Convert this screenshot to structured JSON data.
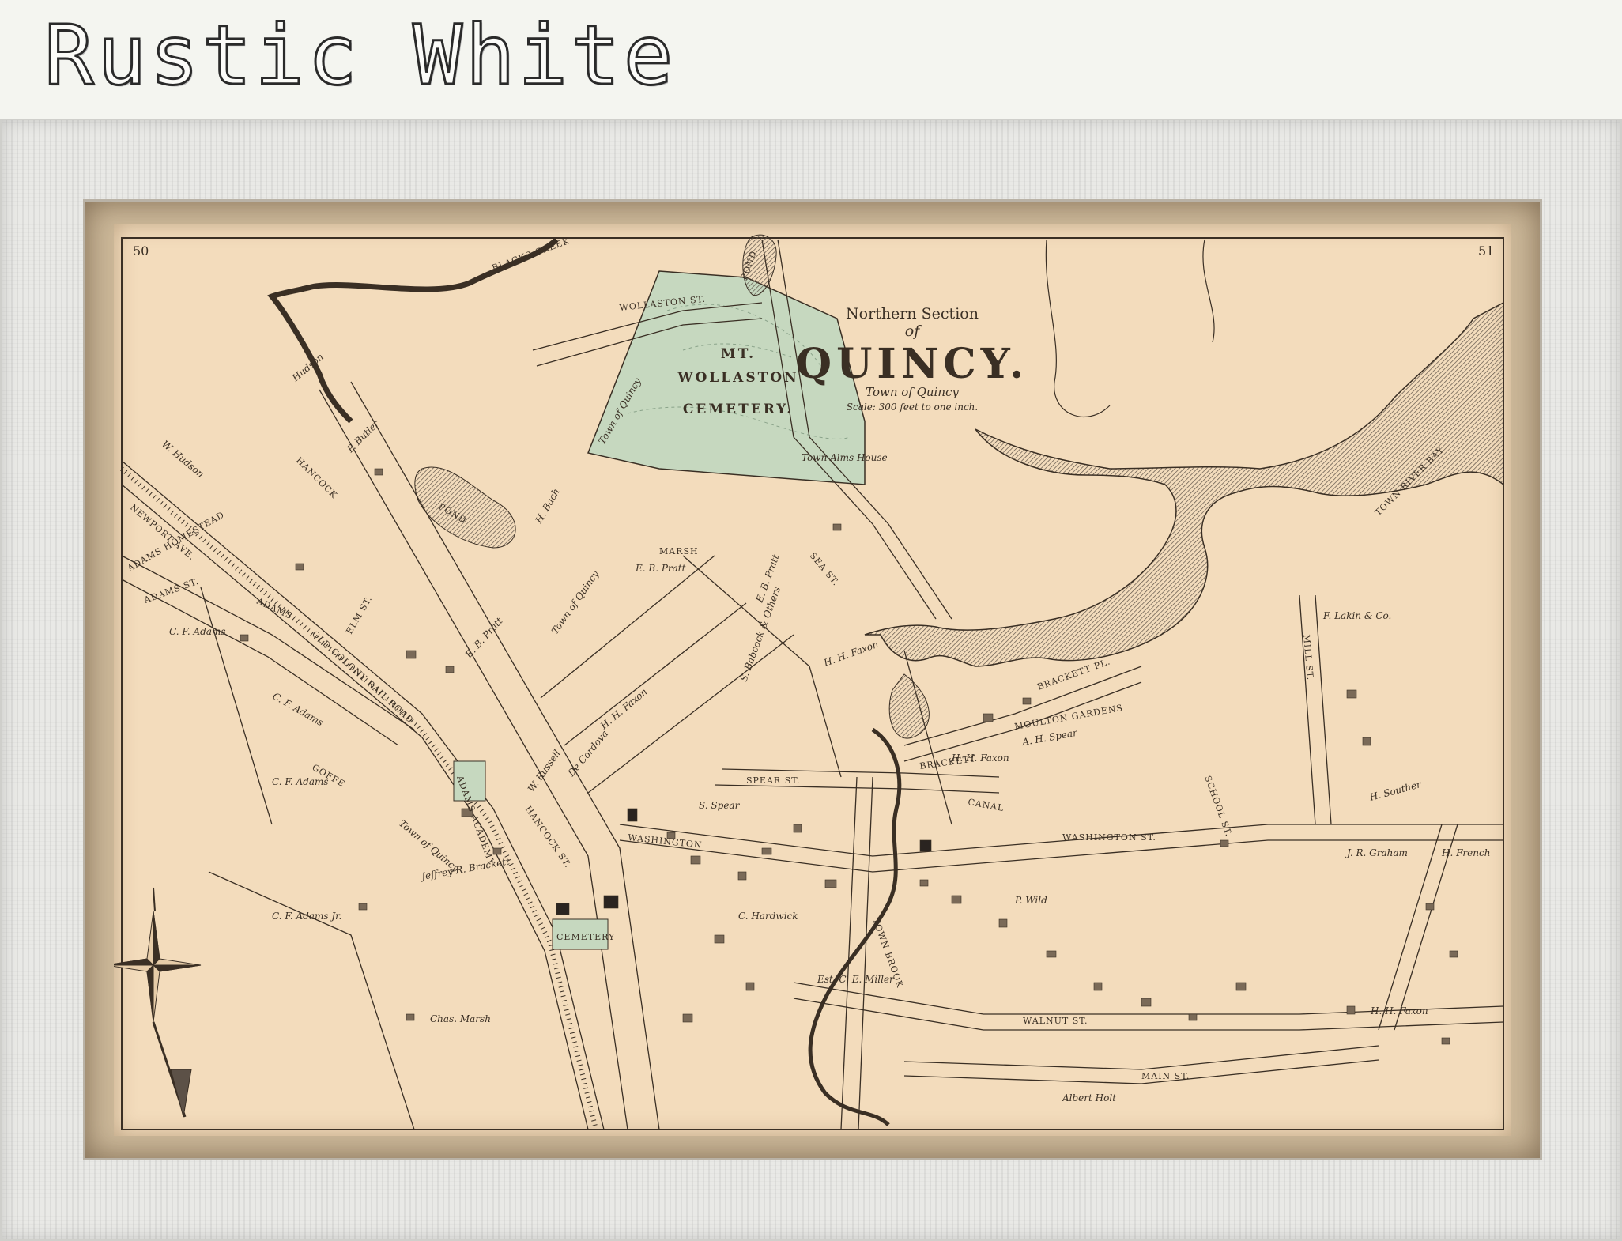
{
  "header": {
    "title": "Rustic White"
  },
  "map": {
    "page_left": "50",
    "page_right": "51",
    "title_line1": "Northern Section",
    "title_of": "of",
    "title_main": "QUINCY.",
    "subtitle": "Town of Quincy",
    "scale": "Scale: 300 feet to one inch.",
    "cemetery": [
      "MT.",
      "WOLLASTON",
      "CEMETERY."
    ],
    "water": {
      "blacks_creek": "BLACKS CREEK",
      "pond_top": "POND",
      "pond_left": "POND",
      "town_river_bay": "TOWN RIVER BAY",
      "town_brook": "TOWN BROOK"
    },
    "streets": {
      "wollaston": "WOLLASTON ST.",
      "hancock": "HANCOCK",
      "hancock_lower": "HANCOCK ST.",
      "newport": "NEWPORT AVE.",
      "adams": "ADAMS ST.",
      "adams_upper": "ADAMS",
      "old_colony": "OLD COLONY RAIL ROAD",
      "washington": "WASHINGTON",
      "washington_east": "WASHINGTON ST.",
      "spear": "SPEAR ST.",
      "brackett": "BRACKETT",
      "brackett_pl": "BRACKETT PL.",
      "walnut": "WALNUT ST.",
      "main": "MAIN ST.",
      "canal": "CANAL",
      "sea": "SEA ST.",
      "goffe": "GOFFE",
      "elm": "ELM ST.",
      "mill": "MILL ST.",
      "school": "SCHOOL ST."
    },
    "owners": {
      "hudson": "Hudson",
      "w_hudson": "W. Hudson",
      "p_butler": "P. Butler",
      "adams_homestead": "ADAMS HOMESTEAD",
      "cf_adams_1": "C. F. Adams",
      "cf_adams_2": "C. F. Adams",
      "cf_adams_3": "C. F. Adams",
      "cf_adams_jr": "C. F. Adams Jr.",
      "eb_pratt_1": "E. B. Pratt",
      "eb_pratt_2": "E. B. Pratt",
      "eb_pratt_3": "E. B. Pratt",
      "marsh": "MARSH",
      "hh_faxon_1": "H. H. Faxon",
      "hh_faxon_2": "H. H. Faxon",
      "hh_faxon_3": "H. H. Faxon",
      "p_wild": "P. Wild",
      "jr_graham": "J. R. Graham",
      "h_french": "H. French",
      "jeffrey_brackett": "Jeffrey R. Brackett",
      "chas_marsh": "Chas. Marsh",
      "h_bach": "H. Bach",
      "s_babcock": "S. Babcock & Others",
      "town_alms_house": "Town Alms House",
      "town_of_quincy_1": "Town of Quincy",
      "town_of_quincy_2": "Town of Quincy",
      "town_of_quincy_3": "Town of Quincy",
      "cemetery_small": "CEMETERY",
      "adams_academy": "ADAMS ACADEMY",
      "moulton_gardens": "MOULTON GARDENS",
      "ah_spear": "A. H. Spear",
      "fp_lakin": "F. Lakin & Co.",
      "h_souther": "H. Souther",
      "h_faxon_sw": "H. H. Faxon",
      "albert_holt": "Albert Holt",
      "w_russell": "W. Russell",
      "c_hardwick": "C. Hardwick",
      "est_ce_miller": "Est. C. E. Miller",
      "s_spear": "S. Spear",
      "de_cordova": "De Cordova"
    }
  },
  "colors": {
    "paper": "#f3dcbc",
    "ink": "#3a2f24",
    "cemetery_green": "#c6d8bf",
    "water_hatch": "#5c5147",
    "frame": "#e9e9e6"
  }
}
